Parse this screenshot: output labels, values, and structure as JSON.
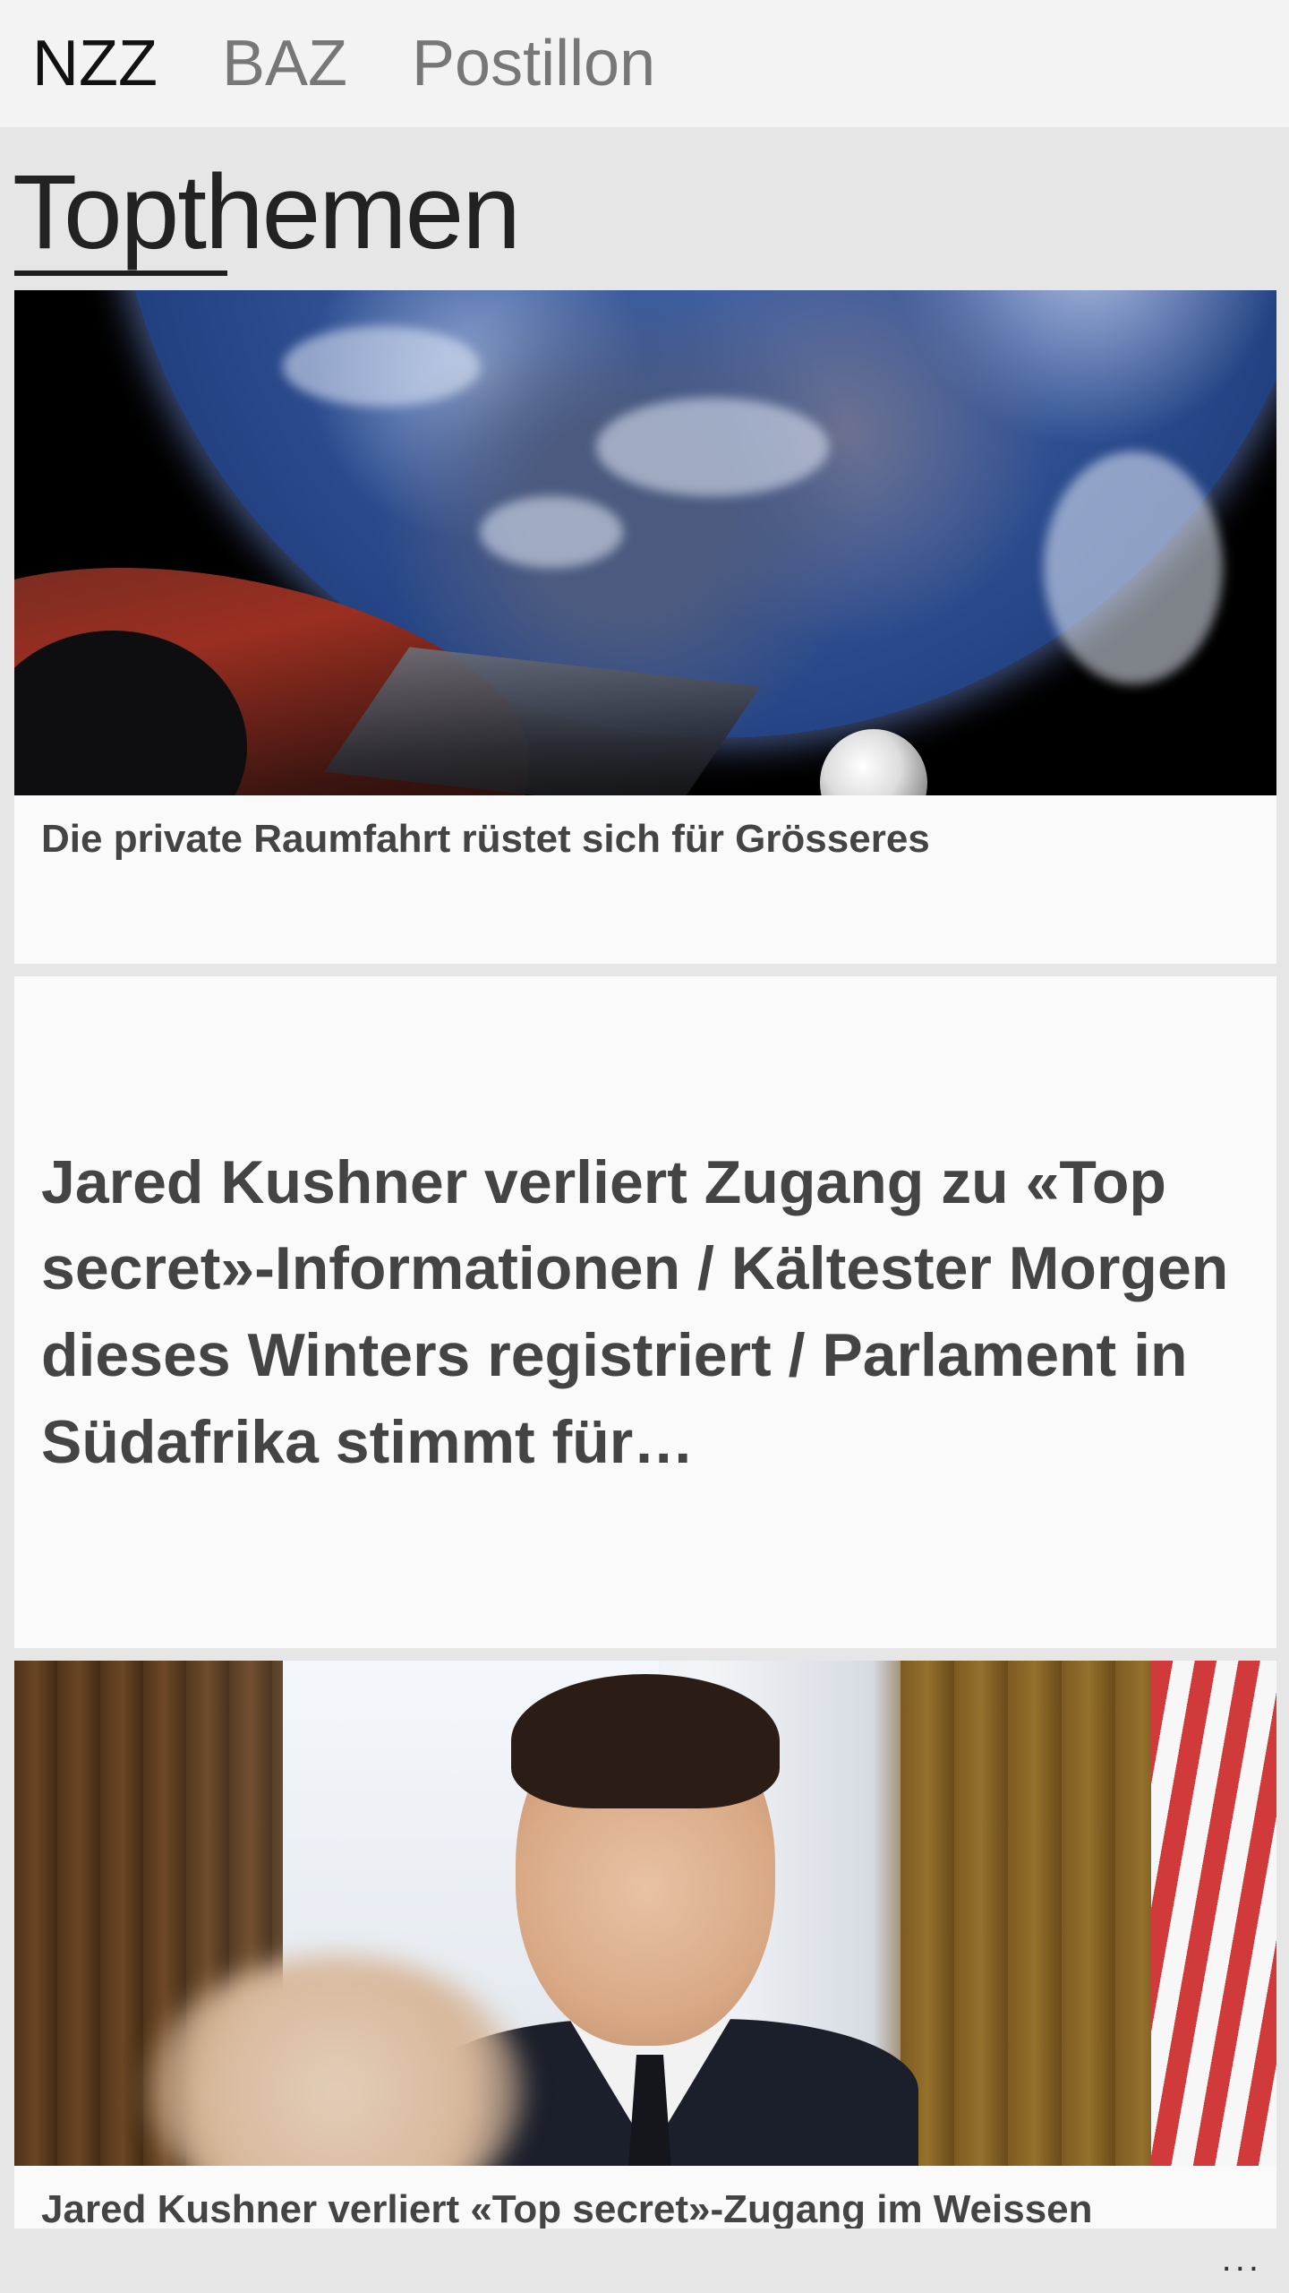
{
  "tabs": [
    {
      "label": "NZZ",
      "active": true
    },
    {
      "label": "BAZ",
      "active": false
    },
    {
      "label": "Postillon",
      "active": false
    }
  ],
  "section": {
    "title": "Topthemen"
  },
  "articles": [
    {
      "image": "spacex-roadster-earth",
      "headline": "Die private Raumfahrt rüstet sich für Grösseres"
    },
    {
      "headline": "Jared Kushner verliert Zugang zu «Top secret»-Informationen / Kältester Morgen dieses Winters registriert / Parlament in Südafrika stimmt für…"
    },
    {
      "image": "jared-kushner-portrait",
      "headline": "Jared Kushner verliert «Top secret»-Zugang im Weissen"
    }
  ],
  "appbar": {
    "more_label": "...",
    "more_icon": "more-icon"
  },
  "colors": {
    "tab_active": "#111111",
    "tab_inactive": "#777777",
    "headline_text": "#444444",
    "page_bg": "#e6e6e6",
    "card_bg": "#fafafa"
  }
}
